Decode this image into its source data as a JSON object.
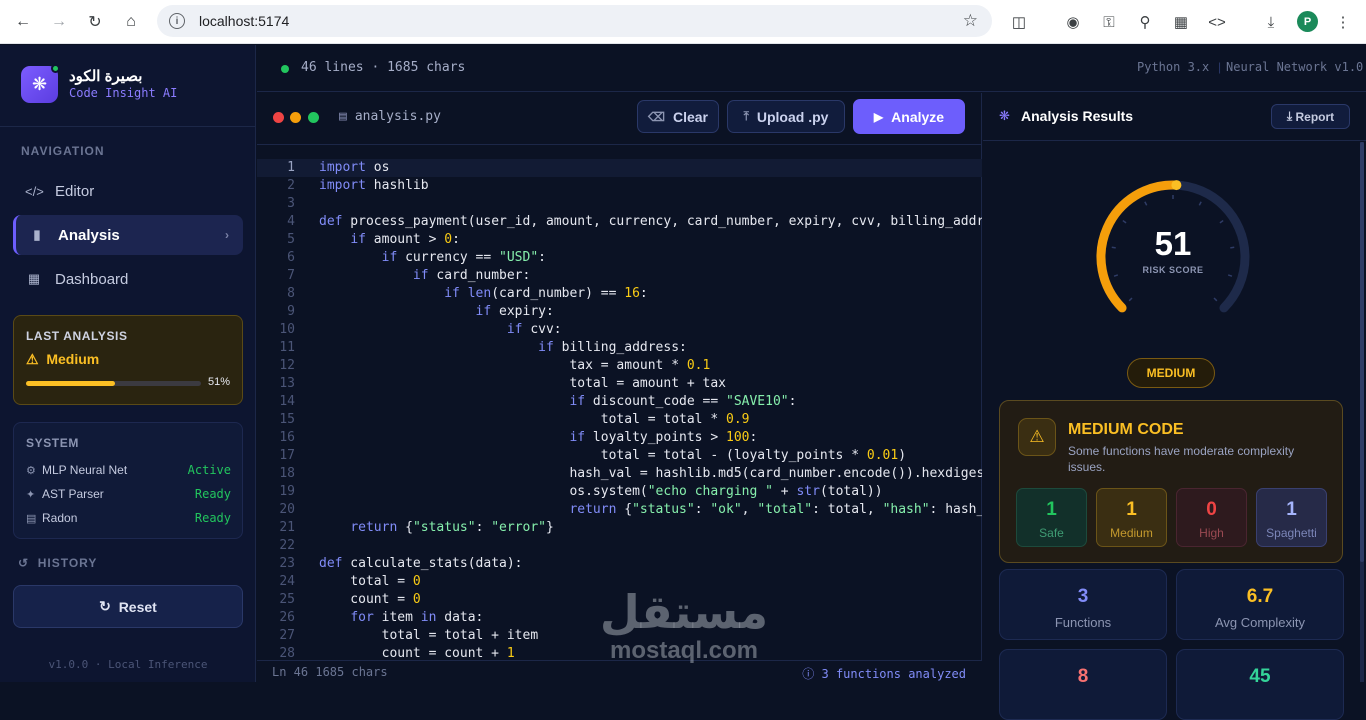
{
  "browser": {
    "url": "localhost:5174",
    "avatar_letter": "P"
  },
  "brand": {
    "name_ar": "بصيرة الكود",
    "name_en": "Code Insight AI"
  },
  "sidebar": {
    "navigation_label": "NAVIGATION",
    "items": [
      {
        "label": "Editor",
        "icon": "code-icon"
      },
      {
        "label": "Analysis",
        "icon": "bar-chart-icon",
        "active": true
      },
      {
        "label": "Dashboard",
        "icon": "grid-icon"
      }
    ],
    "last_analysis": {
      "title": "LAST ANALYSIS",
      "level": "Medium",
      "percent_text": "51%",
      "percent": 0.51
    },
    "system": {
      "title": "SYSTEM",
      "rows": [
        {
          "name": "MLP Neural Net",
          "status": "Active"
        },
        {
          "name": "AST Parser",
          "status": "Ready"
        },
        {
          "name": "Radon",
          "status": "Ready"
        }
      ]
    },
    "history_label": "HISTORY",
    "reset_label": "Reset",
    "version": "v1.0.0 · Local Inference"
  },
  "topbar": {
    "stats": "46 lines · 1685 chars",
    "python": "Python 3.x",
    "model": "Neural Network v1.0"
  },
  "editor": {
    "filename": "analysis.py",
    "clear_label": "Clear",
    "upload_label": "Upload .py",
    "analyze_label": "Analyze",
    "footer_left": "Ln 46   1685 chars",
    "footer_right": "3 functions analyzed"
  },
  "results": {
    "title": "Analysis Results",
    "report_label": "Report",
    "score": "51",
    "score_label": "RISK SCORE",
    "score_fraction": 0.51,
    "level_pill": "MEDIUM",
    "medium_card": {
      "title": "MEDIUM CODE",
      "subtitle": "Some functions have moderate complexity issues.",
      "chips": [
        {
          "value": "1",
          "label": "Safe",
          "color": "#22c55e"
        },
        {
          "value": "1",
          "label": "Medium",
          "color": "#fbbf24"
        },
        {
          "value": "0",
          "label": "High",
          "color": "#ef4444"
        },
        {
          "value": "1",
          "label": "Spaghetti",
          "color": "#a5b4fc"
        }
      ]
    },
    "metrics": [
      {
        "value": "3",
        "label": "Functions",
        "color": "#818cf8"
      },
      {
        "value": "6.7",
        "label": "Avg Complexity",
        "color": "#fbbf24"
      },
      {
        "value": "8",
        "label": "",
        "color": "#f87171"
      },
      {
        "value": "45",
        "label": "",
        "color": "#34d399"
      }
    ]
  },
  "watermark": {
    "ar": "مستقل",
    "en": "mostaql.com"
  },
  "colors": {
    "accent": "#6d5efc",
    "medium": "#fbbf24",
    "ok": "#22c55e"
  }
}
